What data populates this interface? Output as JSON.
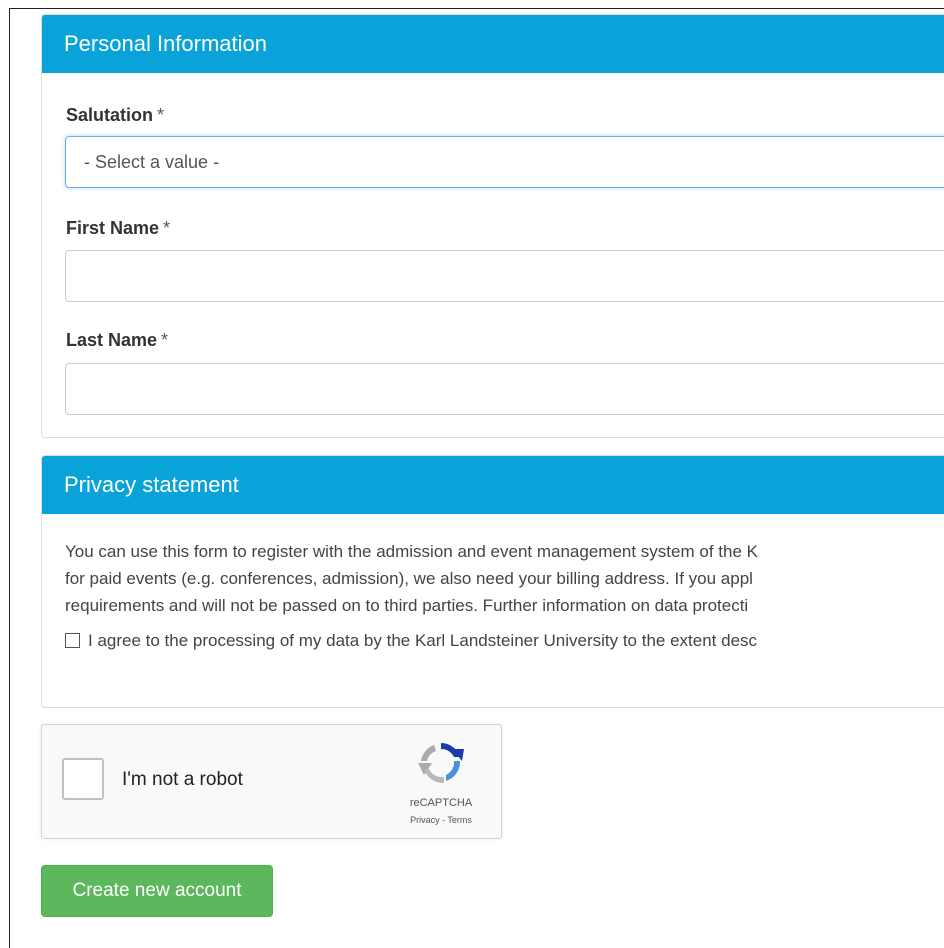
{
  "personal_info": {
    "heading": "Personal Information",
    "salutation": {
      "label": "Salutation",
      "required_marker": "*",
      "selected_value": "- Select a value -"
    },
    "first_name": {
      "label": "First Name",
      "required_marker": "*",
      "value": ""
    },
    "last_name": {
      "label": "Last Name",
      "required_marker": "*",
      "value": ""
    }
  },
  "privacy": {
    "heading": "Privacy statement",
    "lines": [
      "You can use this form to register with the admission and event management system of the K",
      "for paid events (e.g. conferences, admission), we also need your billing address. If you appl",
      "requirements and will not be passed on to third parties. Further information on data protecti"
    ],
    "agree_label": "I agree to the processing of my data by the Karl Landsteiner University to the extent desc",
    "agree_checked": false
  },
  "recaptcha": {
    "label": "I'm not a robot",
    "brand": "reCAPTCHA",
    "links": "Privacy - Terms",
    "checked": false
  },
  "actions": {
    "create_account_label": "Create new account"
  },
  "colors": {
    "panel_heading": "#0aa3d9",
    "button_success": "#5cb85c",
    "focus_border": "#66afe9"
  }
}
